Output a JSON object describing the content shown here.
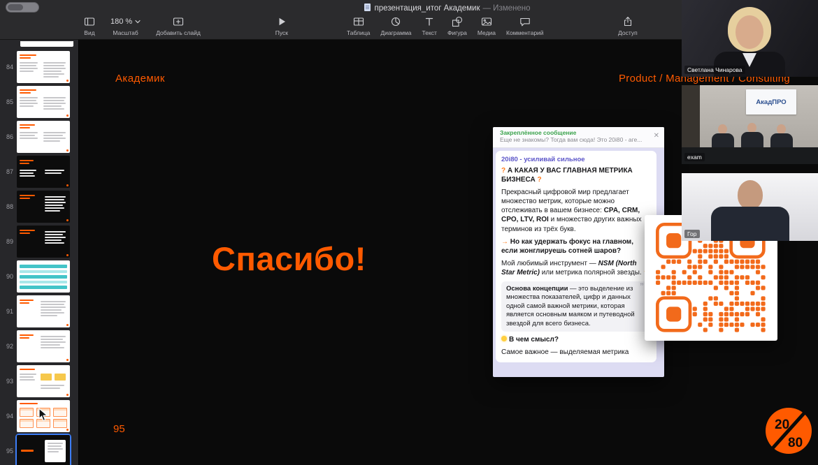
{
  "window": {
    "title": "презентация_итог Академик",
    "modified": "— Изменено"
  },
  "toolbar": {
    "view": "Вид",
    "zoom_value": "180 %",
    "zoom_label": "Масштаб",
    "add_slide": "Добавить слайд",
    "play": "Пуск",
    "table": "Таблица",
    "chart": "Диаграмма",
    "text": "Текст",
    "shape": "Фигура",
    "media": "Медиа",
    "comment": "Комментарий",
    "share": "Доступ"
  },
  "sidebar": {
    "slide_numbers": [
      "84",
      "85",
      "86",
      "87",
      "88",
      "89",
      "90",
      "91",
      "92",
      "93",
      "94",
      "95"
    ]
  },
  "slide": {
    "brand": "Академик",
    "category": "Product / Management / Consulting",
    "title": "Спасибо!",
    "page_number": "95",
    "logo_top": "20",
    "logo_bottom": "80",
    "accent": "#ff5a00"
  },
  "post": {
    "pinned_title": "Закреплённое сообщение",
    "pinned_preview": "Еще не знакомы? Тогда вам сюда! Это 20i80 - аге...",
    "close": "✕",
    "channel": "20i80 - усиливай сильное",
    "q_open": "?",
    "heading": "А КАКАЯ У ВАС ГЛАВНАЯ МЕТРИКА БИЗНЕСА",
    "q_close": "?",
    "p1_a": "Прекрасный цифровой мир предлагает множество метрик, которые можно отслеживать в вашем бизнесе: ",
    "p1_b": "CPA, CRM, CPO, LTV, ROI",
    "p1_c": " и множество других важных терминов из трёх букв.",
    "arrow": "→",
    "p2": "Но как удержать фокус на главном, если жонглируешь сотней шаров?",
    "p3_a": "Мой любимый инструмент — ",
    "p3_b": "NSM (North Star Metric)",
    "p3_c": " или метрика полярной звезды. ",
    "star": "★",
    "quote_lead": "Основа концепции",
    "quote_body": " — это выделение из множества показателей, цифр и данных одной самой важной метрики, которая является основным маяком и путеводной звездой для всего бизнеса.",
    "quote_mark": "””",
    "q2": "В чем смысл?",
    "p4": "Самое важное — выделяемая метрика"
  },
  "qr": {
    "color": "#f26a1b"
  },
  "participants": [
    {
      "name": "Светлана Чинарова"
    },
    {
      "name": "exam",
      "poster": "АкадПРО"
    },
    {
      "name": "Гор"
    }
  ]
}
